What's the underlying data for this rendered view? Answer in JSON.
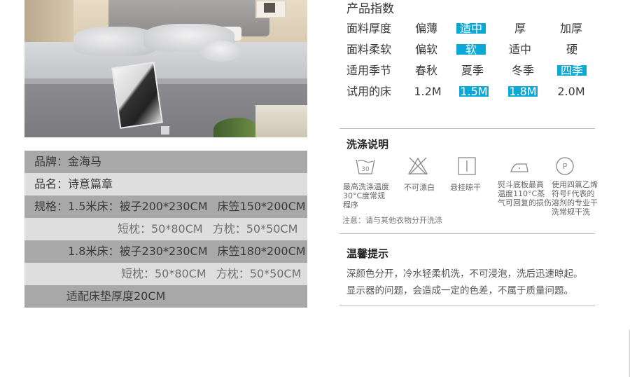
{
  "spec": {
    "brand": "品牌：金海马",
    "name": "品名：诗意篇章",
    "size_a": "规格：1.5米床：被子200*230CM",
    "size_a2": "床笠150*200CM",
    "pillow_a1": "短枕：50*80CM",
    "pillow_a2": "方枕：50*50CM",
    "size_b": "1.8米床：被子230*230CM",
    "size_b2": "床笠180*200CM",
    "pillow_b1": "短枕：50*80CM",
    "pillow_b2": "方枕：50*50CM",
    "fit": "适配床垫厚度20CM"
  },
  "index": {
    "title": "产品指数",
    "rows": [
      {
        "label": "面料厚度",
        "opts": [
          "偏薄",
          "适中",
          "厚",
          "加厚"
        ],
        "selected": 1
      },
      {
        "label": "面料柔软",
        "opts": [
          "偏软",
          "软",
          "适中",
          "硬"
        ],
        "selected": 1
      },
      {
        "label": "适用季节",
        "opts": [
          "春秋",
          "夏季",
          "冬季",
          "四季"
        ],
        "selected": 3
      },
      {
        "label": "试用的床",
        "opts": [
          "1.2M",
          "1.5M",
          "1.8M",
          "2.0M"
        ],
        "selected": [
          1,
          2
        ]
      }
    ]
  },
  "wash": {
    "title": "洗涤说明",
    "icons": [
      {
        "icon": "wash-30-icon",
        "text": [
          "最高洗涤温度",
          "30°C度常规",
          "程序"
        ]
      },
      {
        "icon": "no-bleach-icon",
        "text": [
          "不可漂白"
        ]
      },
      {
        "icon": "hang-dry-icon",
        "text": [
          "悬挂晾干"
        ]
      },
      {
        "icon": "iron-icon",
        "text": [
          "熨斗底板最高",
          "温度110°C蒸",
          "气可回复的损伤"
        ]
      },
      {
        "icon": "dry-clean-p-icon",
        "text": [
          "使用四氯乙烯",
          "符号F代表的",
          "溶剂的专业干",
          "洗常规干洗"
        ]
      }
    ],
    "note": "注意：请与其他衣物分开洗涤"
  },
  "tips": {
    "title": "温馨提示",
    "line1": "深颜色分开，冷水轻柔机洗，不可浸泡，洗后迅速晾起。",
    "line2": "显示器的问题，会造成一定的色差，不属于质量问题。"
  },
  "colors": {
    "highlight": "#0aa9d6",
    "row_dark": "#a8a8a8",
    "row_light": "#dedede"
  }
}
